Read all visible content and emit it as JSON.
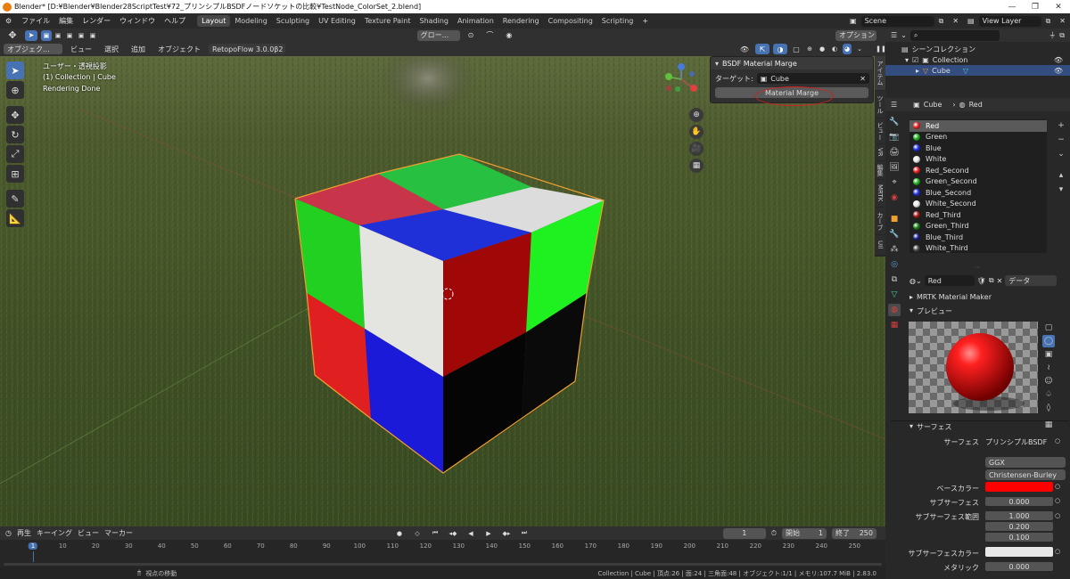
{
  "window": {
    "title": "Blender* [D:¥Blender¥Blender28ScriptTest¥72_プリンシプルBSDFノードソケットの比較¥TestNode_ColorSet_2.blend]",
    "min": "—",
    "max": "❐",
    "close": "✕"
  },
  "menu": [
    "ファイル",
    "編集",
    "レンダー",
    "ウィンドウ",
    "ヘルプ"
  ],
  "workspaces": [
    "Layout",
    "Modeling",
    "Sculpting",
    "UV Editing",
    "Texture Paint",
    "Shading",
    "Animation",
    "Rendering",
    "Compositing",
    "Scripting"
  ],
  "active_workspace": "Layout",
  "scene": {
    "label": "Scene",
    "view_layer": "View Layer"
  },
  "tool_header": {
    "orientation": "グロー...",
    "options": "オプション"
  },
  "vp_header": {
    "mode": "オブジェク...",
    "menus": [
      "ビュー",
      "選択",
      "追加",
      "オブジェクト"
    ],
    "addon": "RetopoFlow 3.0.0β2"
  },
  "viewport": {
    "line1": "ユーザー・透視投影",
    "line2": "(1) Collection | Cube",
    "line3": "Rendering Done"
  },
  "bsdf_panel": {
    "header": "BSDF Material Marge",
    "target_label": "ターゲット:",
    "target_value": "Cube",
    "button": "Material Marge"
  },
  "side_tabs": [
    "アイテム",
    "ツール",
    "ビュー",
    "VR",
    "編集",
    "MRTK",
    "カーブ",
    "UIl"
  ],
  "outliner": {
    "root": "シーンコレクション",
    "collection": "Collection",
    "object": "Cube"
  },
  "properties": {
    "object": "Cube",
    "material_tab": "Red",
    "materials": [
      {
        "name": "Red",
        "color": "#e02020"
      },
      {
        "name": "Green",
        "color": "#20b020"
      },
      {
        "name": "Blue",
        "color": "#2030e0"
      },
      {
        "name": "White",
        "color": "#e8e8e8"
      },
      {
        "name": "Red_Second",
        "color": "#e02020"
      },
      {
        "name": "Green_Second",
        "color": "#20b020"
      },
      {
        "name": "Blue_Second",
        "color": "#2030e0"
      },
      {
        "name": "White_Second",
        "color": "#e8e8e8"
      },
      {
        "name": "Red_Third",
        "color": "#a01818"
      },
      {
        "name": "Green_Third",
        "color": "#188018"
      },
      {
        "name": "Blue_Third",
        "color": "#182080"
      },
      {
        "name": "White_Third",
        "color": "#444444"
      }
    ],
    "slot_name": "Red",
    "link": "データ",
    "mrtk": "MRTK Material Maker",
    "preview": "プレビュー",
    "surface_section": "サーフェス",
    "surface_label": "サーフェス",
    "surface_value": "プリンシプルBSDF",
    "distribution": "GGX",
    "sss_method": "Christensen-Burley",
    "base_color_label": "ベースカラー",
    "base_color": "#ff0000",
    "subsurface_label": "サブサーフェス",
    "subsurface_value": "0.000",
    "sss_radius_label": "サブサーフェス範囲",
    "sss_radius": [
      "1.000",
      "0.200",
      "0.100"
    ],
    "sss_color_label": "サブサーフェスカラー",
    "metallic_label": "メタリック",
    "metallic_value": "0.000"
  },
  "timeline": {
    "menus": [
      "再生",
      "キーイング",
      "ビュー",
      "マーカー"
    ],
    "current": "1",
    "start_label": "開始",
    "start": "1",
    "end_label": "終了",
    "end": "250",
    "ticks": [
      "1",
      "10",
      "20",
      "30",
      "40",
      "50",
      "60",
      "70",
      "80",
      "90",
      "100",
      "110",
      "120",
      "130",
      "140",
      "150",
      "160",
      "170",
      "180",
      "190",
      "200",
      "210",
      "220",
      "230",
      "240",
      "250"
    ]
  },
  "status": {
    "left": "視点の移動",
    "right": "Collection | Cube | 頂点:26 | 面:24 | 三角面:48 | オブジェクト:1/1 | メモリ:107.7 MiB | 2.83.0"
  }
}
